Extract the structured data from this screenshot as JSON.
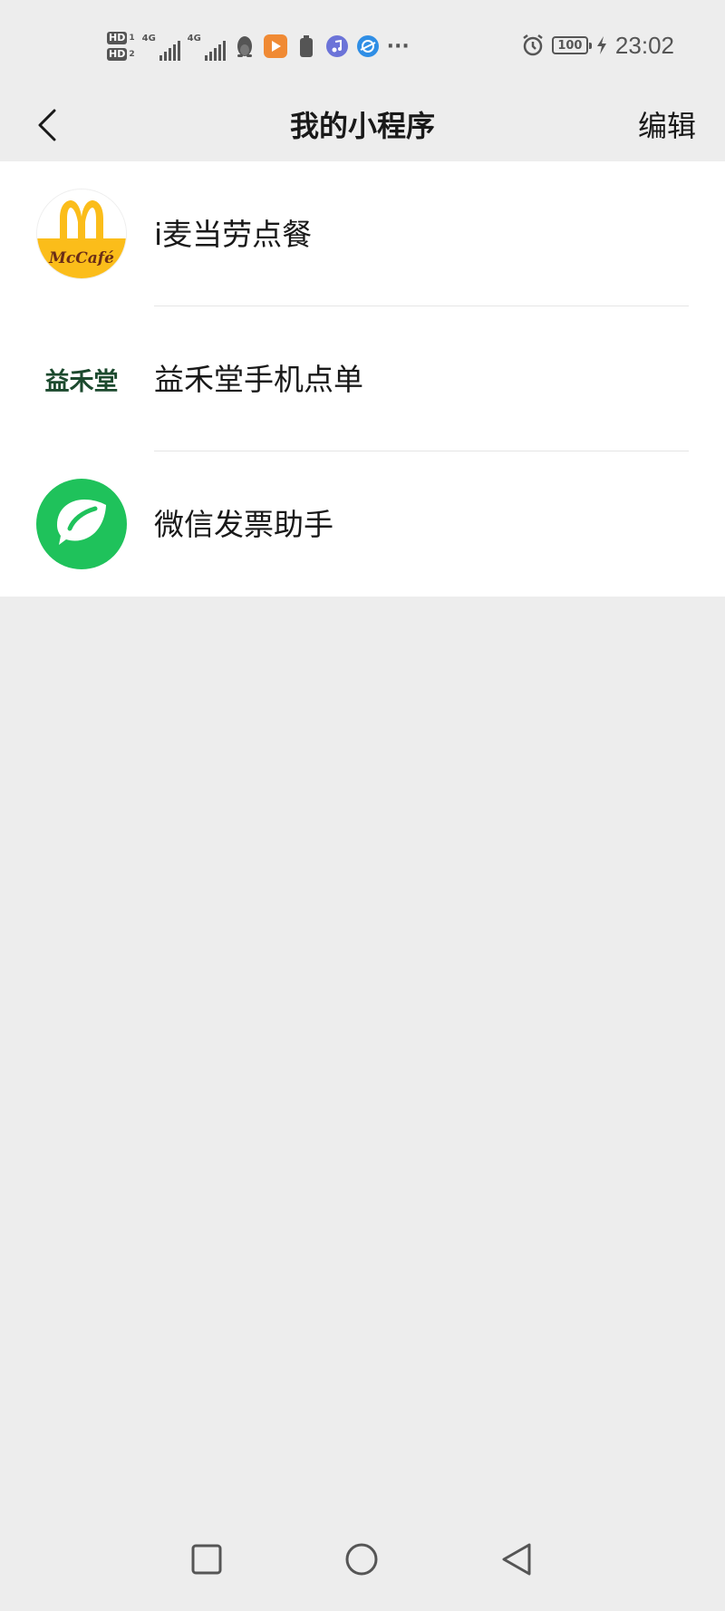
{
  "status_bar": {
    "sim1": "HD",
    "sim1_index": "1",
    "sim2": "HD",
    "sim2_index": "2",
    "net1": "4G",
    "net2": "4G",
    "more": "···",
    "battery": "100",
    "time": "23:02"
  },
  "nav": {
    "title": "我的小程序",
    "edit": "编辑"
  },
  "items": [
    {
      "label": "i麦当劳点餐",
      "logo_text": "McCafé"
    },
    {
      "label": "益禾堂手机点单",
      "logo_text": "益禾堂"
    },
    {
      "label": "微信发票助手"
    }
  ],
  "colors": {
    "background": "#ededed",
    "list_bg": "#ffffff",
    "mcd_yellow": "#fbbd1a",
    "invoice_green": "#1fc25b",
    "yht_green": "#1c4a2e"
  }
}
